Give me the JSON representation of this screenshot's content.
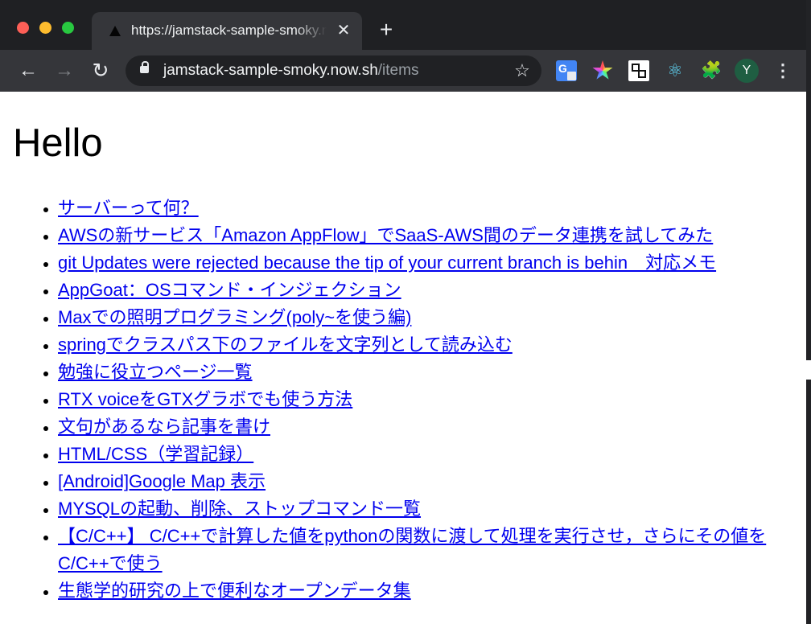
{
  "browser": {
    "tab": {
      "title": "https://jamstack-sample-smoky.now.sh/items",
      "close_glyph": "✕"
    },
    "new_tab_glyph": "+",
    "nav": {
      "back_glyph": "←",
      "forward_glyph": "→",
      "reload_glyph": "↻"
    },
    "address": {
      "host": "jamstack-sample-smoky.now.sh",
      "path": "/items"
    },
    "star_glyph": "☆",
    "react_glyph": "⚛",
    "puzzle_glyph": "🧩",
    "profile_initial": "Y",
    "menu_glyph": "⋮"
  },
  "page": {
    "heading": "Hello",
    "items": [
      "サーバーって何？",
      "AWSの新サービス「Amazon AppFlow」でSaaS-AWS間のデータ連携を試してみた",
      "git Updates were rejected because the tip of your current branch is behin　対応メモ",
      "AppGoat：OSコマンド・インジェクション",
      "Maxでの照明プログラミング(poly~を使う編)",
      "springでクラスパス下のファイルを文字列として読み込む",
      "勉強に役立つページ一覧",
      "RTX voiceをGTXグラボでも使う方法",
      "文句があるなら記事を書け",
      "HTML/CSS（学習記録）",
      "[Android]Google Map 表示",
      "MYSQLの起動、削除、ストップコマンド一覧",
      "【C/C++】 C/C++で計算した値をpythonの関数に渡して処理を実行させ，さらにその値をC/C++で使う",
      "生態学的研究の上で便利なオープンデータ集"
    ]
  }
}
